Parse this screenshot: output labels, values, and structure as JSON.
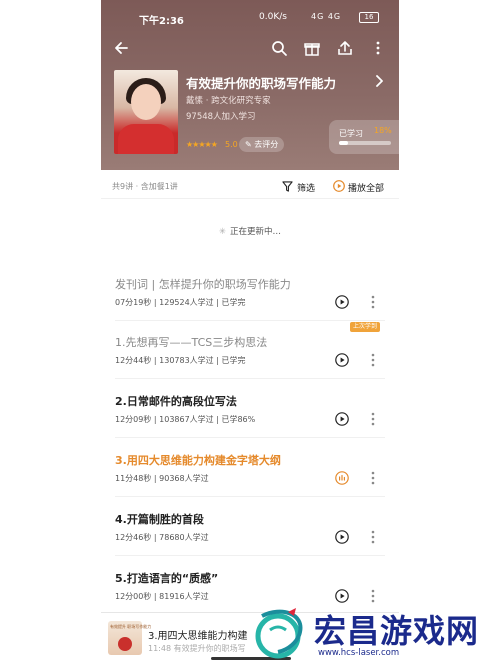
{
  "statusbar": {
    "time": "下午2:36",
    "network_speed": "0.0K/s",
    "signal": "4G 4G",
    "battery": "16"
  },
  "course": {
    "title": "有效提升你的职场写作能力",
    "author": "戴愫 · 跨文化研究专家",
    "enrolled": "97548人加入学习",
    "stars": "★★★★★",
    "rating": "5.0",
    "rate_label": "去评分"
  },
  "progress": {
    "label": "已学习",
    "value": "18%",
    "fraction": 0.18
  },
  "toolbar": {
    "count": "共9讲 · 含加餐1讲",
    "filter_label": "筛选",
    "play_all_label": "播放全部"
  },
  "status": {
    "updating": "正在更新中…"
  },
  "lessons": [
    {
      "title": "发刊词 | 怎样提升你的职场写作能力",
      "meta": "07分19秒 | 129524人学过 | 已学完"
    },
    {
      "title": "1.先想再写——TCS三步构思法",
      "meta": "12分44秒 | 130783人学过 | 已学完"
    },
    {
      "title": "2.日常邮件的高段位写法",
      "meta": "12分09秒 | 103867人学过 | 已学86%"
    },
    {
      "title": "3.用四大思维能力构建金字塔大纲",
      "meta": "11分48秒 | 90368人学过"
    },
    {
      "title": "4.开篇制胜的首段",
      "meta": "12分46秒 | 78680人学过"
    },
    {
      "title": "5.打造语言的“质感”",
      "meta": "12分00秒 | 81916人学过"
    }
  ],
  "last_learned_tag": "上次学到",
  "mini_player": {
    "title": "3.用四大思维能力构建",
    "subtitle": "11:48 有效提升你的职场写",
    "thumb_text": "有效提升 职场写作能力"
  },
  "watermark": {
    "title": "宏昌游戏网",
    "url": "www.hcs-laser.com"
  },
  "colors": {
    "header": "#8a6a66",
    "accent": "#e58a2c",
    "star": "#f5a623",
    "watermark": "#1b2a8c"
  }
}
